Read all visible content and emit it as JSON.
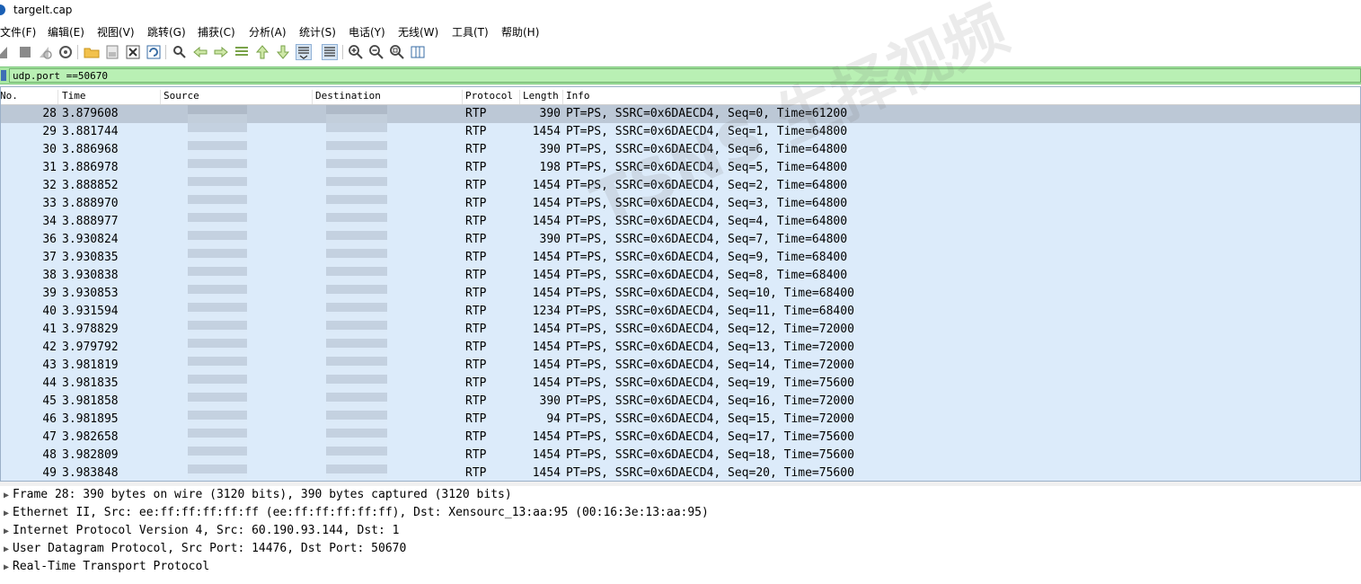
{
  "window": {
    "title": "targeIt.cap"
  },
  "menu": [
    "文件(F)",
    "编辑(E)",
    "视图(V)",
    "跳转(G)",
    "捕获(C)",
    "分析(A)",
    "统计(S)",
    "电话(Y)",
    "无线(W)",
    "工具(T)",
    "帮助(H)"
  ],
  "toolbar": {
    "icons": [
      "shark-fin-start-icon",
      "stop-icon",
      "restart-icon",
      "capture-options-icon",
      "open-folder-icon",
      "save-file-icon",
      "close-file-icon",
      "reload-icon",
      "find-packet-icon",
      "go-back-icon",
      "go-forward-icon",
      "go-to-packet-icon",
      "go-first-icon",
      "go-last-icon",
      "auto-scroll-icon",
      "colorize-icon",
      "zoom-in-icon",
      "zoom-out-icon",
      "zoom-normal-icon",
      "resize-columns-icon"
    ]
  },
  "filter": {
    "value": "udp.port ==50670"
  },
  "columns": [
    "No.",
    "Time",
    "Source",
    "Destination",
    "Protocol",
    "Length",
    "Info"
  ],
  "packets": [
    {
      "no": "28",
      "time": "3.879608",
      "src": "",
      "dst": "",
      "proto": "RTP",
      "len": "390",
      "info": "PT=PS, SSRC=0x6DAECD4, Seq=0, Time=61200",
      "selected": true
    },
    {
      "no": "29",
      "time": "3.881744",
      "src": "",
      "dst": "",
      "proto": "RTP",
      "len": "1454",
      "info": "PT=PS, SSRC=0x6DAECD4, Seq=1, Time=64800"
    },
    {
      "no": "30",
      "time": "3.886968",
      "src": "",
      "dst": "",
      "proto": "RTP",
      "len": "390",
      "info": "PT=PS, SSRC=0x6DAECD4, Seq=6, Time=64800"
    },
    {
      "no": "31",
      "time": "3.886978",
      "src": "",
      "dst": "",
      "proto": "RTP",
      "len": "198",
      "info": "PT=PS, SSRC=0x6DAECD4, Seq=5, Time=64800"
    },
    {
      "no": "32",
      "time": "3.888852",
      "src": "",
      "dst": "",
      "proto": "RTP",
      "len": "1454",
      "info": "PT=PS, SSRC=0x6DAECD4, Seq=2, Time=64800"
    },
    {
      "no": "33",
      "time": "3.888970",
      "src": "",
      "dst": "",
      "proto": "RTP",
      "len": "1454",
      "info": "PT=PS, SSRC=0x6DAECD4, Seq=3, Time=64800"
    },
    {
      "no": "34",
      "time": "3.888977",
      "src": "",
      "dst": "",
      "proto": "RTP",
      "len": "1454",
      "info": "PT=PS, SSRC=0x6DAECD4, Seq=4, Time=64800"
    },
    {
      "no": "36",
      "time": "3.930824",
      "src": "",
      "dst": "",
      "proto": "RTP",
      "len": "390",
      "info": "PT=PS, SSRC=0x6DAECD4, Seq=7, Time=64800"
    },
    {
      "no": "37",
      "time": "3.930835",
      "src": "",
      "dst": "",
      "proto": "RTP",
      "len": "1454",
      "info": "PT=PS, SSRC=0x6DAECD4, Seq=9, Time=68400"
    },
    {
      "no": "38",
      "time": "3.930838",
      "src": "",
      "dst": "",
      "proto": "RTP",
      "len": "1454",
      "info": "PT=PS, SSRC=0x6DAECD4, Seq=8, Time=68400"
    },
    {
      "no": "39",
      "time": "3.930853",
      "src": "",
      "dst": "",
      "proto": "RTP",
      "len": "1454",
      "info": "PT=PS, SSRC=0x6DAECD4, Seq=10, Time=68400"
    },
    {
      "no": "40",
      "time": "3.931594",
      "src": "",
      "dst": "",
      "proto": "RTP",
      "len": "1234",
      "info": "PT=PS, SSRC=0x6DAECD4, Seq=11, Time=68400"
    },
    {
      "no": "41",
      "time": "3.978829",
      "src": "",
      "dst": "",
      "proto": "RTP",
      "len": "1454",
      "info": "PT=PS, SSRC=0x6DAECD4, Seq=12, Time=72000"
    },
    {
      "no": "42",
      "time": "3.979792",
      "src": "",
      "dst": "",
      "proto": "RTP",
      "len": "1454",
      "info": "PT=PS, SSRC=0x6DAECD4, Seq=13, Time=72000"
    },
    {
      "no": "43",
      "time": "3.981819",
      "src": "",
      "dst": "",
      "proto": "RTP",
      "len": "1454",
      "info": "PT=PS, SSRC=0x6DAECD4, Seq=14, Time=72000"
    },
    {
      "no": "44",
      "time": "3.981835",
      "src": "",
      "dst": "",
      "proto": "RTP",
      "len": "1454",
      "info": "PT=PS, SSRC=0x6DAECD4, Seq=19, Time=75600"
    },
    {
      "no": "45",
      "time": "3.981858",
      "src": "",
      "dst": "",
      "proto": "RTP",
      "len": "390",
      "info": "PT=PS, SSRC=0x6DAECD4, Seq=16, Time=72000"
    },
    {
      "no": "46",
      "time": "3.981895",
      "src": "",
      "dst": "",
      "proto": "RTP",
      "len": "94",
      "info": "PT=PS, SSRC=0x6DAECD4, Seq=15, Time=72000"
    },
    {
      "no": "47",
      "time": "3.982658",
      "src": "",
      "dst": "",
      "proto": "RTP",
      "len": "1454",
      "info": "PT=PS, SSRC=0x6DAECD4, Seq=17, Time=75600"
    },
    {
      "no": "48",
      "time": "3.982809",
      "src": "",
      "dst": "",
      "proto": "RTP",
      "len": "1454",
      "info": "PT=PS, SSRC=0x6DAECD4, Seq=18, Time=75600"
    },
    {
      "no": "49",
      "time": "3.983848",
      "src": "",
      "dst": "",
      "proto": "RTP",
      "len": "1454",
      "info": "PT=PS, SSRC=0x6DAECD4, Seq=20, Time=75600"
    }
  ],
  "details": [
    "Frame 28: 390 bytes on wire (3120 bits), 390 bytes captured (3120 bits)",
    "Ethernet II, Src: ee:ff:ff:ff:ff:ff (ee:ff:ff:ff:ff:ff), Dst: Xensourc_13:aa:95 (00:16:3e:13:aa:95)",
    "Internet Protocol Version 4, Src: 60.190.93.144, Dst: 1",
    "User Datagram Protocol, Src Port: 14476, Dst Port: 50670",
    "Real-Time Transport Protocol"
  ],
  "watermark": {
    "text": "TSNS 生择视频"
  },
  "colors": {
    "row_bg": "#dcebfa",
    "selected_row": "#bcc8d6",
    "filter_ok": "#a8e6a3"
  }
}
